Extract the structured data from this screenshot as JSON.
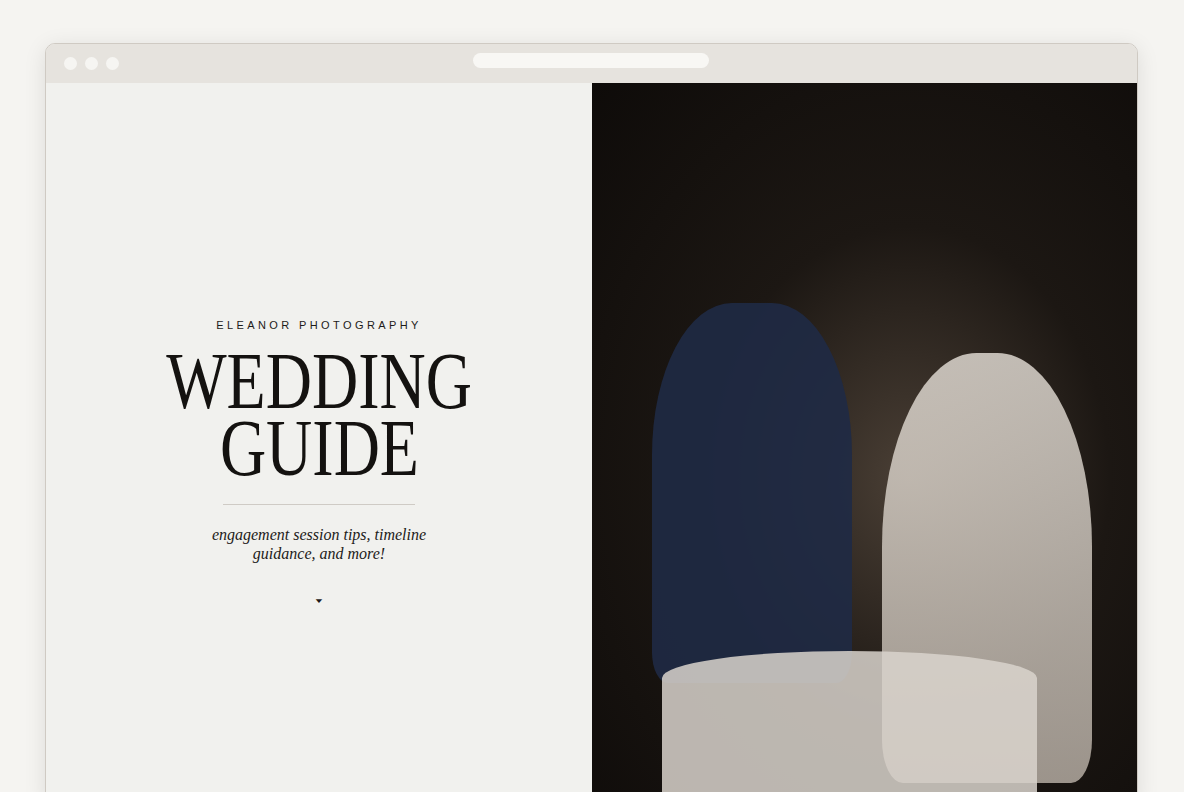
{
  "brand": "ELEANOR PHOTOGRAPHY",
  "title": [
    "WEDDING",
    "GUIDE"
  ],
  "subtitle": [
    "engagement session tips, timeline",
    "guidance, and more!"
  ],
  "scroll_icon": "▼"
}
